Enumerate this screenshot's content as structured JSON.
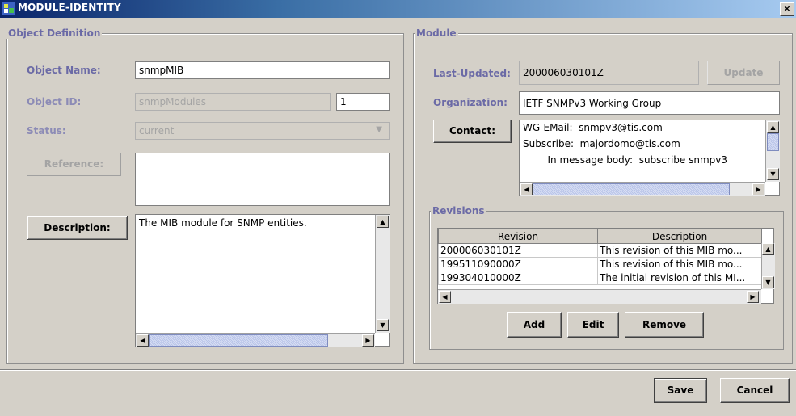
{
  "window": {
    "title": "MODULE-IDENTITY",
    "close_glyph": "×"
  },
  "object_definition": {
    "legend": "Object Definition",
    "object_name_label": "Object Name:",
    "object_name_value": "snmpMIB",
    "object_id_label": "Object ID:",
    "object_id_value": "snmpModules",
    "object_id_number": "1",
    "status_label": "Status:",
    "status_value": "current",
    "reference_button": "Reference:",
    "reference_text": "",
    "description_button": "Description:",
    "description_text": "The MIB module for SNMP entities."
  },
  "module": {
    "legend": "Module",
    "last_updated_label": "Last-Updated:",
    "last_updated_value": "200006030101Z",
    "update_button": "Update",
    "organization_label": "Organization:",
    "organization_value": "IETF SNMPv3 Working Group",
    "contact_button": "Contact:",
    "contact_lines": [
      "WG-EMail:  snmpv3@tis.com",
      "Subscribe:  majordomo@tis.com",
      "        In message body:  subscribe snmpv3"
    ]
  },
  "revisions": {
    "legend": "Revisions",
    "columns": [
      "Revision",
      "Description"
    ],
    "rows": [
      {
        "revision": "200006030101Z",
        "description": "This revision of this MIB mo..."
      },
      {
        "revision": "199511090000Z",
        "description": "This revision of this MIB mo..."
      },
      {
        "revision": "199304010000Z",
        "description": "The initial revision of this MI..."
      }
    ],
    "add_button": "Add",
    "edit_button": "Edit",
    "remove_button": "Remove"
  },
  "footer": {
    "save_button": "Save",
    "cancel_button": "Cancel"
  },
  "colors": {
    "label": "#6b6aa6",
    "background": "#d4d0c8",
    "title_start": "#0a246a"
  }
}
